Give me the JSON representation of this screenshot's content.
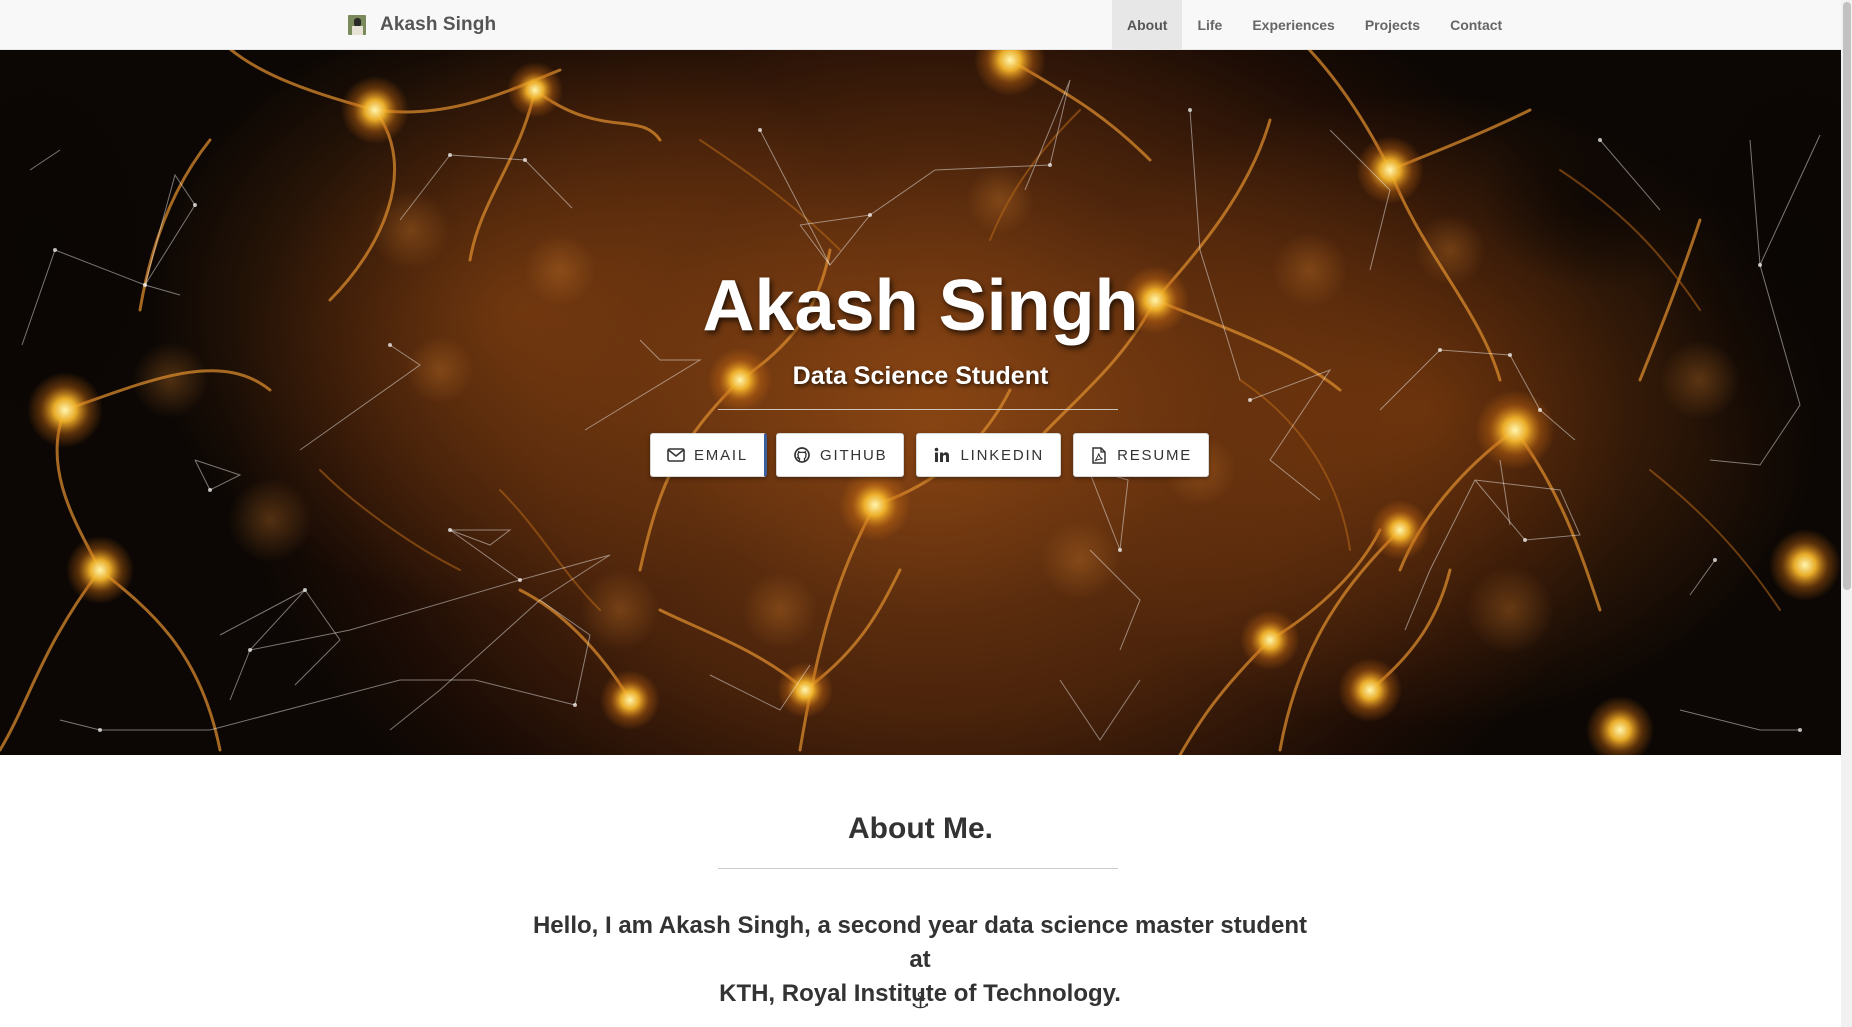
{
  "navbar": {
    "brand": "Akash Singh",
    "items": [
      {
        "label": "About",
        "active": true
      },
      {
        "label": "Life",
        "active": false
      },
      {
        "label": "Experiences",
        "active": false
      },
      {
        "label": "Projects",
        "active": false
      },
      {
        "label": "Contact",
        "active": false
      }
    ]
  },
  "hero": {
    "title": "Akash Singh",
    "subtitle": "Data Science Student",
    "buttons": [
      {
        "label": "EMAIL",
        "icon": "envelope-icon"
      },
      {
        "label": "GITHUB",
        "icon": "github-icon"
      },
      {
        "label": "LINKEDIN",
        "icon": "linkedin-icon"
      },
      {
        "label": "RESUME",
        "icon": "pdf-file-icon"
      }
    ]
  },
  "about": {
    "heading": "About Me.",
    "line1": "Hello, I am Akash Singh, a second year data science master student at",
    "line2": "KTH, Royal Institute of Technology.",
    "anchor_glyph": "⚓"
  },
  "colors": {
    "navbar_bg": "#f8f8f8",
    "nav_active_bg": "#e7e7e7",
    "text": "#333333",
    "hero_glow": "#f0a020"
  }
}
